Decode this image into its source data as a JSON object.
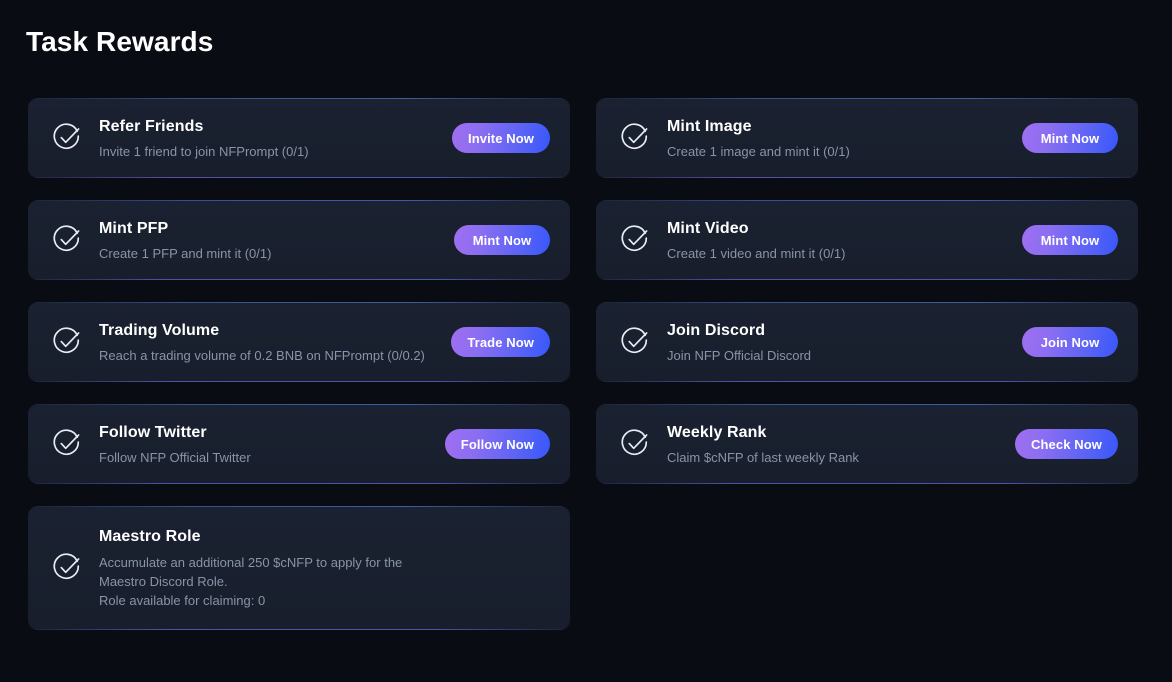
{
  "page": {
    "title": "Task Rewards",
    "background_color": "#0a0c14",
    "card_color": "#1a2130",
    "accent_gradient_from": "#a06ff0",
    "accent_gradient_to": "#3857fb",
    "title_color": "#ffffff",
    "description_color": "#8a94a6"
  },
  "tasks": [
    {
      "icon": "check-circle-icon",
      "title": "Refer Friends",
      "description": "Invite 1 friend to join NFPrompt (0/1)",
      "action_label": "Invite Now",
      "has_action": true
    },
    {
      "icon": "check-circle-icon",
      "title": "Mint Image",
      "description": "Create 1 image and mint it (0/1)",
      "action_label": "Mint Now",
      "has_action": true
    },
    {
      "icon": "check-circle-icon",
      "title": "Mint PFP",
      "description": "Create 1 PFP and mint it (0/1)",
      "action_label": "Mint Now",
      "has_action": true
    },
    {
      "icon": "check-circle-icon",
      "title": "Mint Video",
      "description": "Create 1 video and mint it (0/1)",
      "action_label": "Mint Now",
      "has_action": true
    },
    {
      "icon": "check-circle-icon",
      "title": "Trading Volume",
      "description": "Reach a trading volume of 0.2 BNB on NFPrompt (0/0.2)",
      "action_label": "Trade Now",
      "has_action": true
    },
    {
      "icon": "check-circle-icon",
      "title": "Join Discord",
      "description": "Join NFP Official Discord",
      "action_label": "Join Now",
      "has_action": true
    },
    {
      "icon": "check-circle-icon",
      "title": "Follow Twitter",
      "description": "Follow NFP Official Twitter",
      "action_label": "Follow Now",
      "has_action": true
    },
    {
      "icon": "check-circle-icon",
      "title": "Weekly Rank",
      "description": "Claim $cNFP of last weekly Rank",
      "action_label": "Check Now",
      "has_action": true
    },
    {
      "icon": "check-circle-icon",
      "title": "Maestro Role",
      "description": "Accumulate an additional 250 $cNFP to apply for the\nMaestro Discord Role.\nRole available for claiming: 0",
      "action_label": "",
      "has_action": false
    }
  ]
}
